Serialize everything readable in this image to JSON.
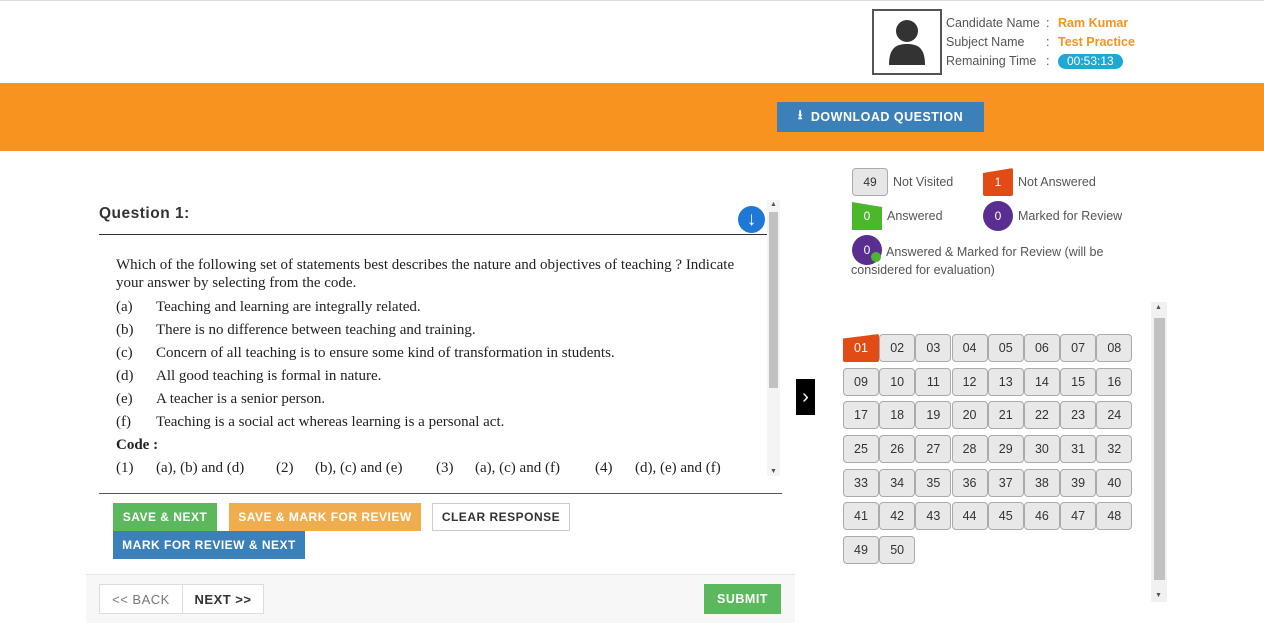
{
  "candidate": {
    "photo_icon": "user-avatar-icon",
    "name_label": "Candidate Name",
    "name": "Ram Kumar",
    "subject_label": "Subject Name",
    "subject": "Test Practice",
    "time_label": "Remaining Time",
    "time": "00:53:13",
    "sep": ":"
  },
  "download_button": {
    "label": "DOWNLOAD QUESTION",
    "icon": "download-icon"
  },
  "question": {
    "title": "Question 1:",
    "stem": "Which of the following set of statements best describes the nature and objectives of teaching ? Indicate your answer by selecting from the code.",
    "options": [
      {
        "key": "(a)",
        "text": "Teaching and learning are integrally related."
      },
      {
        "key": "(b)",
        "text": "There is no difference between teaching and training."
      },
      {
        "key": "(c)",
        "text": "Concern of all teaching is to ensure some kind of transformation in students."
      },
      {
        "key": "(d)",
        "text": "All good teaching is formal in nature."
      },
      {
        "key": "(e)",
        "text": "A teacher is a senior person."
      },
      {
        "key": "(f)",
        "text": "Teaching is a social act whereas learning is a personal act."
      }
    ],
    "code_heading": "Code :",
    "codes": [
      {
        "key": "(1)",
        "text": "(a), (b) and (d)"
      },
      {
        "key": "(2)",
        "text": "(b), (c) and (e)"
      },
      {
        "key": "(3)",
        "text": "(a), (c) and (f)"
      },
      {
        "key": "(4)",
        "text": "(d), (e) and (f)"
      }
    ]
  },
  "actions": {
    "save_next": "SAVE & NEXT",
    "save_mark": "SAVE & MARK FOR REVIEW",
    "clear": "CLEAR RESPONSE",
    "mark_next": "MARK FOR REVIEW & NEXT",
    "back": "<< BACK",
    "next": "NEXT >>",
    "submit": "SUBMIT"
  },
  "legend": {
    "not_visited": {
      "count": "49",
      "label": "Not Visited"
    },
    "not_answered": {
      "count": "1",
      "label": "Not Answered"
    },
    "answered": {
      "count": "0",
      "label": "Answered"
    },
    "marked": {
      "count": "0",
      "label": "Marked for Review"
    },
    "answered_marked": {
      "count": "0",
      "label": "Answered & Marked for Review (will be considered for evaluation)"
    }
  },
  "palette": {
    "questions": [
      "01",
      "02",
      "03",
      "04",
      "05",
      "06",
      "07",
      "08",
      "09",
      "10",
      "11",
      "12",
      "13",
      "14",
      "15",
      "16",
      "17",
      "18",
      "19",
      "20",
      "21",
      "22",
      "23",
      "24",
      "25",
      "26",
      "27",
      "28",
      "29",
      "30",
      "31",
      "32",
      "33",
      "34",
      "35",
      "36",
      "37",
      "38",
      "39",
      "40",
      "41",
      "42",
      "43",
      "44",
      "45",
      "46",
      "47",
      "48",
      "49",
      "50"
    ],
    "current": "01"
  },
  "colors": {
    "orange": "#f7931e",
    "blue": "#3b80b9",
    "green": "#5cb85c",
    "not_answered": "#e14b14",
    "marked": "#5a2d91"
  }
}
